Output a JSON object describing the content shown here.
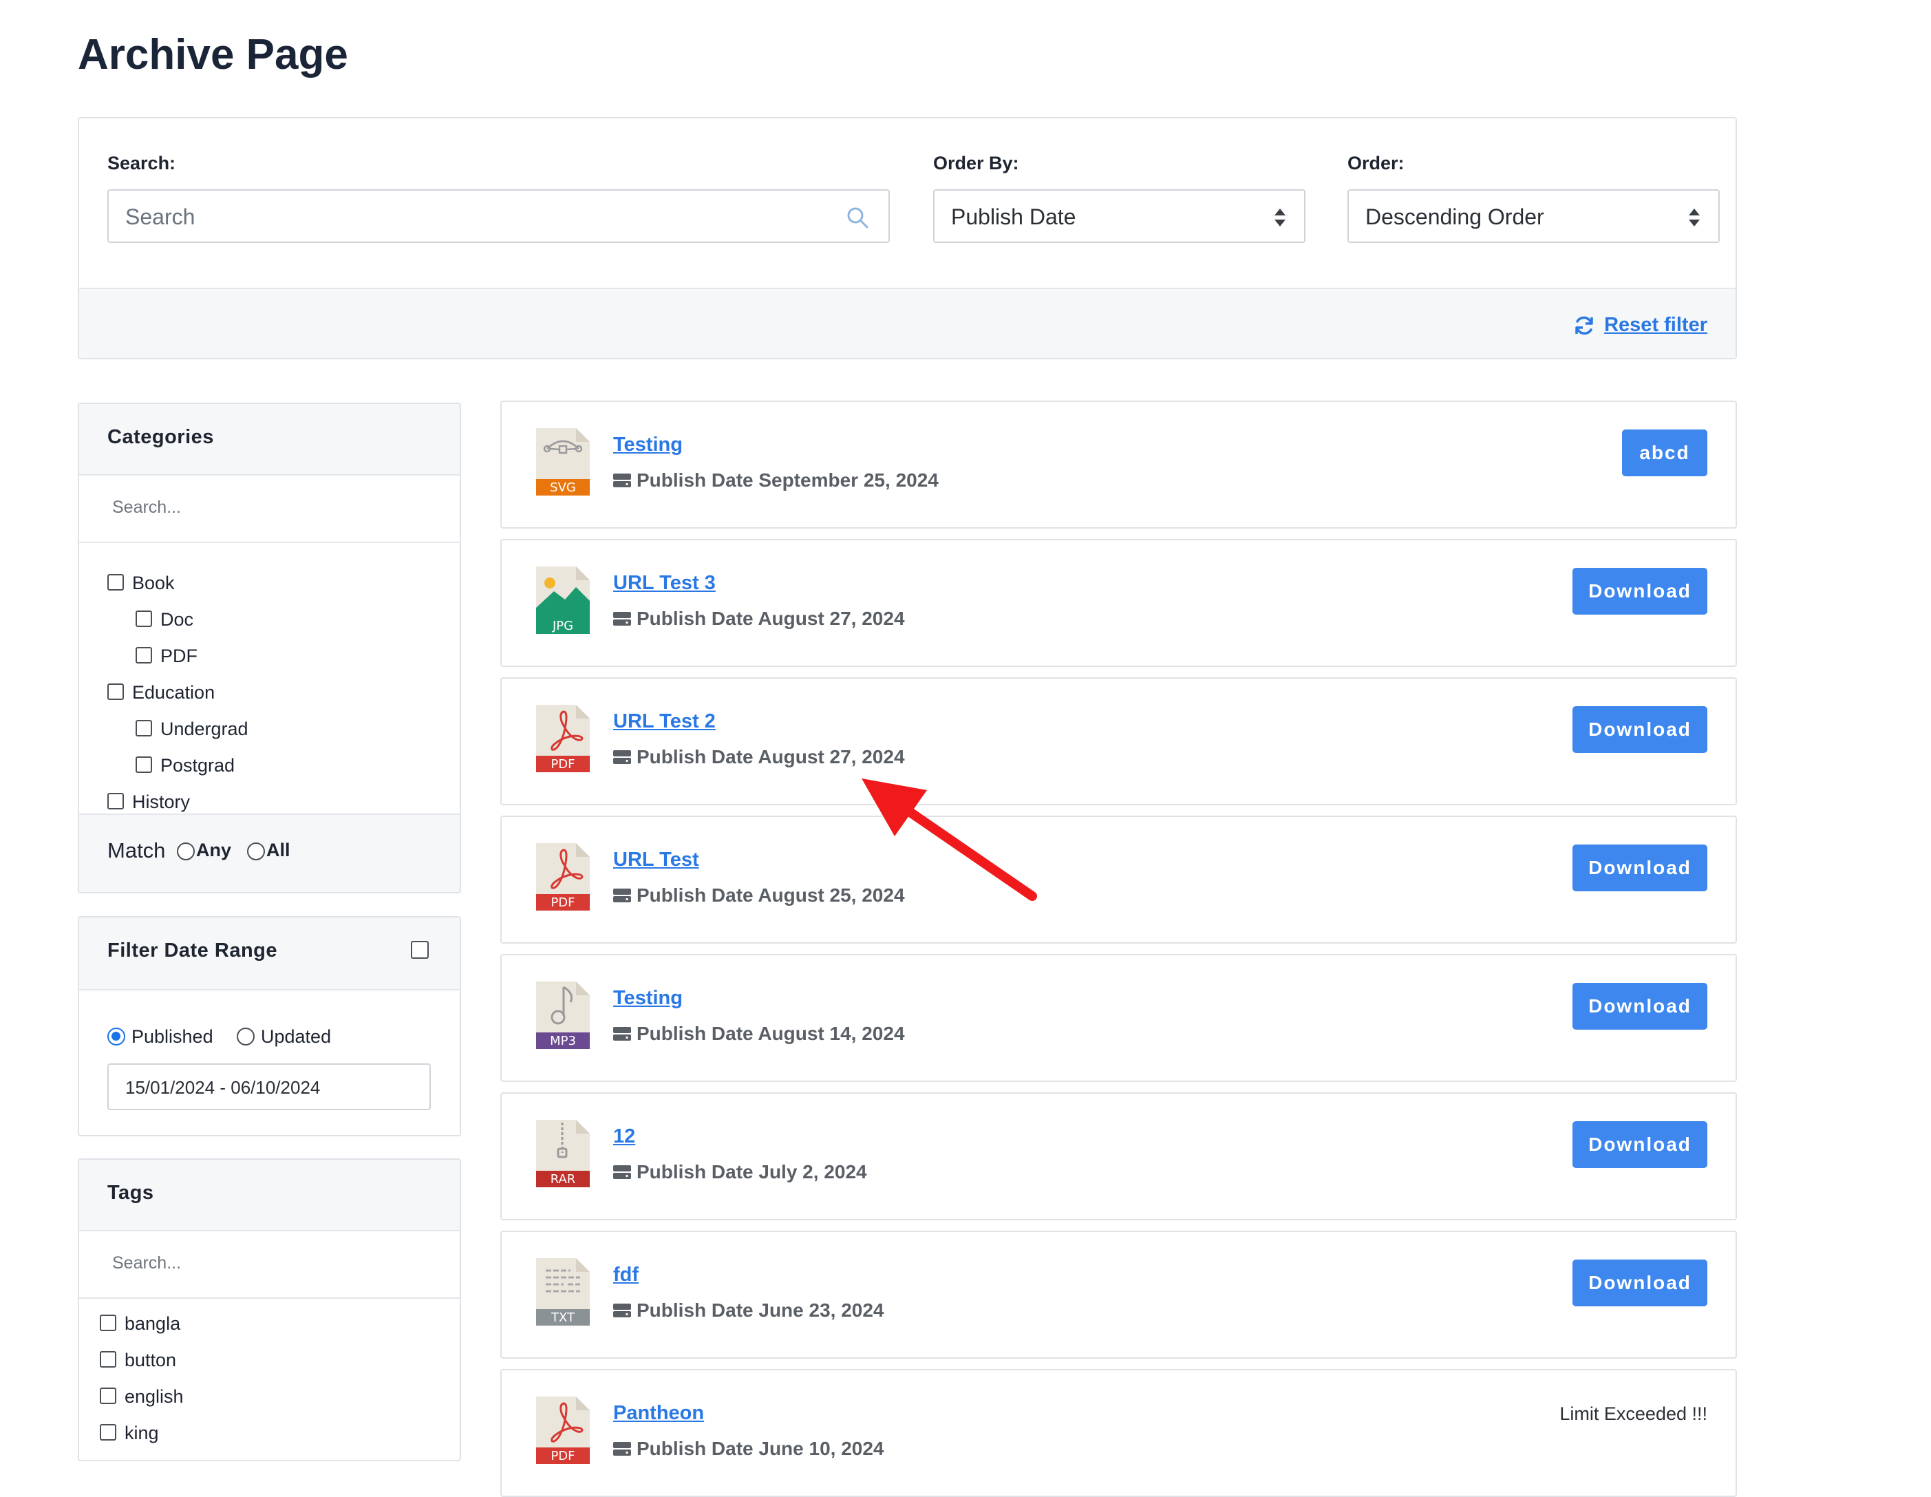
{
  "page": {
    "title": "Archive Page"
  },
  "filters": {
    "search": {
      "label": "Search:",
      "placeholder": "Search"
    },
    "order_by": {
      "label": "Order By:",
      "value": "Publish Date"
    },
    "order": {
      "label": "Order:",
      "value": "Descending Order"
    },
    "reset_label": "Reset filter"
  },
  "categories": {
    "title": "Categories",
    "search_placeholder": "Search...",
    "items": [
      {
        "label": "Book",
        "level": 0
      },
      {
        "label": "Doc",
        "level": 1
      },
      {
        "label": "PDF",
        "level": 1
      },
      {
        "label": "Education",
        "level": 0
      },
      {
        "label": "Undergrad",
        "level": 1
      },
      {
        "label": "Postgrad",
        "level": 1
      },
      {
        "label": "History",
        "level": 0
      }
    ],
    "match_label": "Match",
    "match_any": "Any",
    "match_all": "All"
  },
  "date_range": {
    "title": "Filter Date Range",
    "published_label": "Published",
    "updated_label": "Updated",
    "selected": "Published",
    "value": "15/01/2024 - 06/10/2024"
  },
  "tags": {
    "title": "Tags",
    "search_placeholder": "Search...",
    "items": [
      "bangla",
      "button",
      "english",
      "king"
    ]
  },
  "documents": [
    {
      "title": "Testing",
      "type": "SVG",
      "date": "Publish Date September 25, 2024",
      "action": "abcd"
    },
    {
      "title": "URL Test 3",
      "type": "JPG",
      "date": "Publish Date August 27, 2024",
      "action": "Download"
    },
    {
      "title": "URL Test 2",
      "type": "PDF",
      "date": "Publish Date August 27, 2024",
      "action": "Download"
    },
    {
      "title": "URL Test",
      "type": "PDF",
      "date": "Publish Date August 25, 2024",
      "action": "Download"
    },
    {
      "title": "Testing",
      "type": "MP3",
      "date": "Publish Date August 14, 2024",
      "action": "Download"
    },
    {
      "title": "12",
      "type": "RAR",
      "date": "Publish Date July 2, 2024",
      "action": "Download"
    },
    {
      "title": "fdf",
      "type": "TXT",
      "date": "Publish Date June 23, 2024",
      "action": "Download"
    },
    {
      "title": "Pantheon",
      "type": "PDF",
      "date": "Publish Date June 10, 2024",
      "action_text": "Limit Exceeded !!!"
    }
  ],
  "colors": {
    "link": "#2a78e4",
    "button": "#3d87ee",
    "annotation_arrow": "#f0191c",
    "svg_badge": "#e8760c",
    "jpg_badge": "#1b9a70",
    "pdf_badge": "#d63a33",
    "mp3_badge": "#6b4a91",
    "rar_badge": "#c0302b",
    "txt_badge": "#8a9296"
  }
}
